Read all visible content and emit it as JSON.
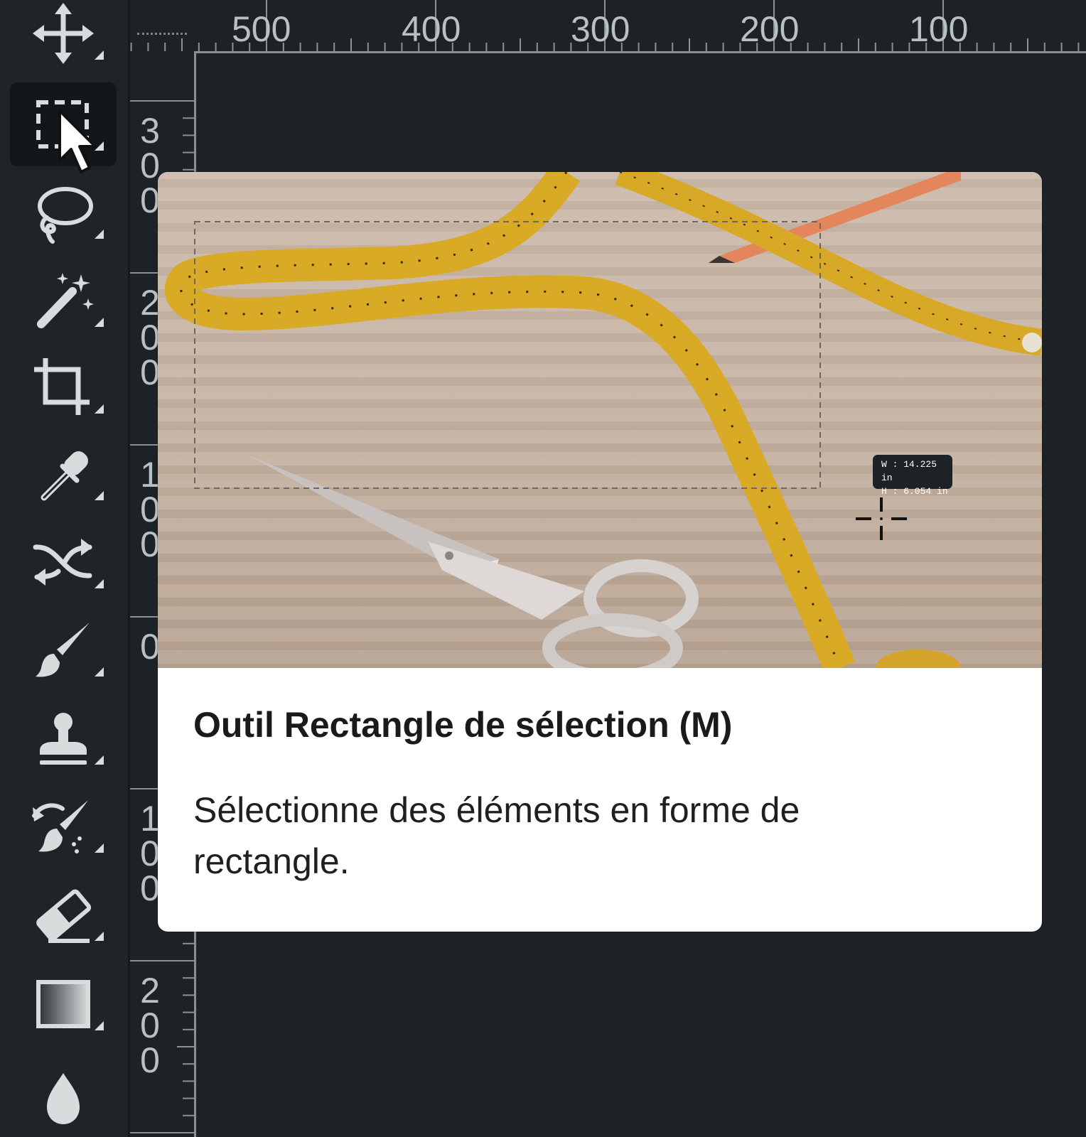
{
  "toolbar": {
    "tools": [
      {
        "icon": "move-icon",
        "label": "Déplacement"
      },
      {
        "icon": "rectangular-marquee-icon",
        "label": "Rectangle de sélection",
        "active": true
      },
      {
        "icon": "lasso-icon",
        "label": "Lasso"
      },
      {
        "icon": "magic-wand-icon",
        "label": "Baguette magique"
      },
      {
        "icon": "crop-icon",
        "label": "Recadrage"
      },
      {
        "icon": "eyedropper-icon",
        "label": "Pipette"
      },
      {
        "icon": "content-aware-move-icon",
        "label": "Déplacement basé sur le contenu"
      },
      {
        "icon": "brush-icon",
        "label": "Pinceau"
      },
      {
        "icon": "clone-stamp-icon",
        "label": "Tampon de duplication"
      },
      {
        "icon": "history-brush-icon",
        "label": "Forme d'historique"
      },
      {
        "icon": "eraser-icon",
        "label": "Gomme"
      },
      {
        "icon": "gradient-icon",
        "label": "Dégradé"
      },
      {
        "icon": "blur-icon",
        "label": "Goutte"
      }
    ]
  },
  "ruler": {
    "top_labels": [
      "500",
      "400",
      "300",
      "200",
      "100"
    ],
    "left_labels": [
      "300",
      "200",
      "100",
      "0",
      "100",
      "200"
    ]
  },
  "tooltip": {
    "title": "Outil Rectangle de sélection (M)",
    "description": "Sélectionne des éléments en forme de rectangle.",
    "width_readout": "W : 14.225 in",
    "height_readout": "H :  6.054 in"
  },
  "colors": {
    "background": "#1d2226",
    "icon": "#d7dcdc",
    "card": "#ffffff",
    "tape": "#e0b22c"
  }
}
